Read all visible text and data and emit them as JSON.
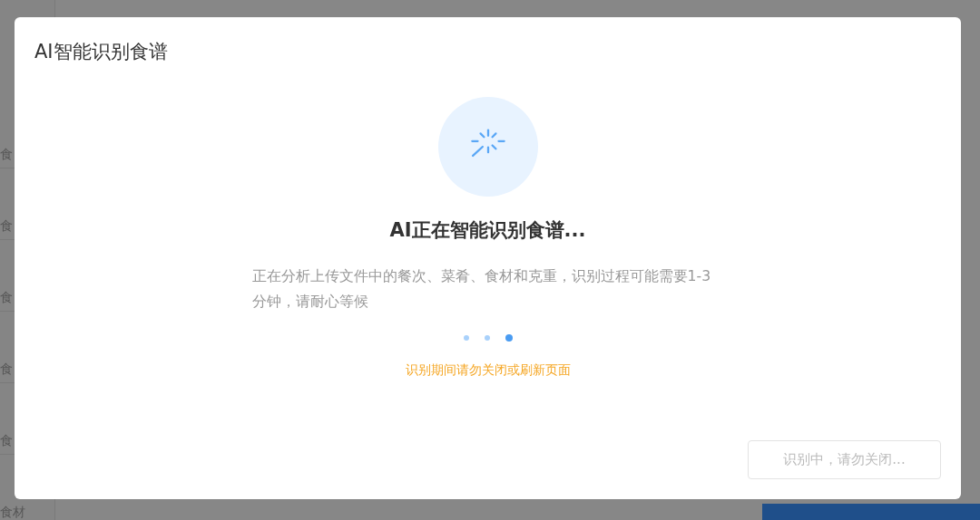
{
  "background": {
    "row_labels": [
      "食",
      "食",
      "食",
      "食",
      "食",
      "食材"
    ]
  },
  "dialog": {
    "title": "AI智能识别食谱",
    "status_title": "AI正在智能识别食谱...",
    "description": "正在分析上传文件中的餐次、菜肴、食材和克重，识别过程可能需要1-3分钟，请耐心等候",
    "progress_dots": [
      {
        "selected": false
      },
      {
        "selected": false
      },
      {
        "selected": true
      }
    ],
    "warning": "识别期间请勿关闭或刷新页面",
    "button": {
      "label": "识别中，请勿关闭...",
      "disabled": true
    }
  }
}
